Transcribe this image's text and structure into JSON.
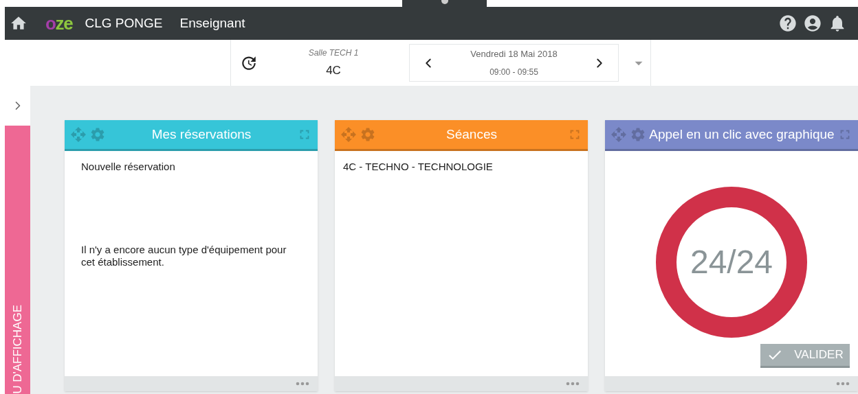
{
  "header": {
    "logo": [
      {
        "text": "o",
        "color": "#a43ea8"
      },
      {
        "text": "ze",
        "color": "#8dc63f"
      }
    ],
    "school": "CLG PONGE",
    "role": "Enseignant"
  },
  "course_bar": {
    "room": "Salle TECH 1",
    "class": "4C",
    "date": "Vendredi 18 Mai 2018",
    "time": "09:00 - 09:55"
  },
  "sidebar": {
    "label": "U D'AFFICHAGE"
  },
  "widgets": [
    {
      "kind": "text",
      "title": "Mes réservations",
      "color": "#36c5d8",
      "items": [
        "Nouvelle réservation"
      ],
      "message": "Il n'y a encore aucun type d'équipement pour cet établissement."
    },
    {
      "kind": "text",
      "title": "Séances",
      "color": "#fb8f27",
      "items": [
        "4C - TECHNO - TECHNOLOGIE"
      ]
    },
    {
      "kind": "attendance",
      "title": "Appel en un clic avec graphique",
      "color": "#7b89c9",
      "count": "24/24",
      "level": 1,
      "button": "VALIDER"
    }
  ]
}
